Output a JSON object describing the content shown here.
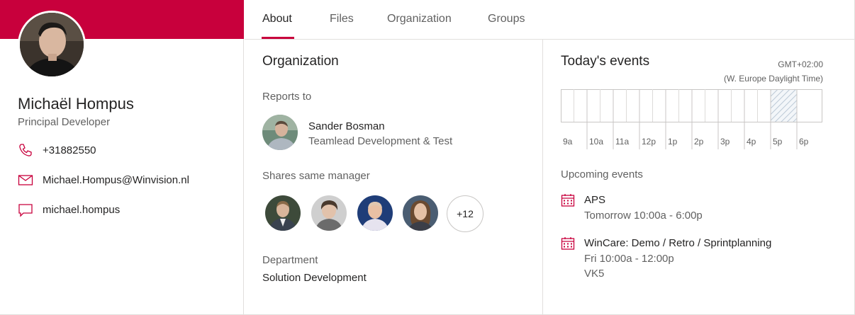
{
  "profile": {
    "name": "Michaël Hompus",
    "title": "Principal Developer",
    "phone": "+31882550",
    "email": "Michael.Hompus@Winvision.nl",
    "chat": "michael.hompus"
  },
  "tabs": [
    {
      "label": "About",
      "active": true
    },
    {
      "label": "Files",
      "active": false
    },
    {
      "label": "Organization",
      "active": false
    },
    {
      "label": "Groups",
      "active": false
    }
  ],
  "organization": {
    "heading": "Organization",
    "reports_to_label": "Reports to",
    "manager": {
      "name": "Sander Bosman",
      "title": "Teamlead Development & Test"
    },
    "shares_label": "Shares same manager",
    "more_count": "+12",
    "department_label": "Department",
    "department": "Solution Development"
  },
  "events": {
    "heading": "Today's events",
    "timezone_offset": "GMT+02:00",
    "timezone_name": "(W. Europe Daylight Time)",
    "hours": [
      "9a",
      "10a",
      "11a",
      "12p",
      "1p",
      "2p",
      "3p",
      "4p",
      "5p",
      "6p"
    ],
    "upcoming_label": "Upcoming events",
    "upcoming": [
      {
        "title": "APS",
        "when": "Tomorrow 10:00a - 6:00p",
        "location": ""
      },
      {
        "title": "WinCare: Demo / Retro / Sprintplanning",
        "when": "Fri 10:00a - 12:00p",
        "location": "VK5"
      }
    ]
  },
  "colors": {
    "accent": "#c8003c",
    "border": "#e1dfdd",
    "muted": "#616161"
  }
}
